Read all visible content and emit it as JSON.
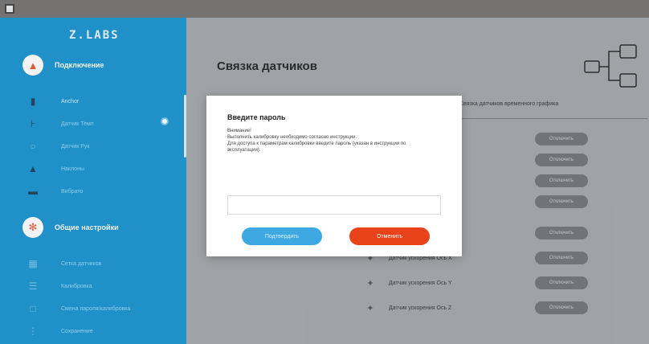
{
  "sidebar": {
    "logo": "Z.LABS",
    "section1": {
      "label": "Подключение"
    },
    "items1": [
      {
        "label": "Anchor",
        "icon": "sensor-icon"
      },
      {
        "label": "Датчик Темп",
        "icon": "thermometer-icon"
      },
      {
        "label": "Датчик Рук",
        "icon": "hand-icon"
      },
      {
        "label": "Наклоны",
        "icon": "image-icon"
      },
      {
        "label": "Вибрато",
        "icon": "image-icon"
      }
    ],
    "section2": {
      "label": "Общие настройки"
    },
    "items2": [
      {
        "label": "Сетка датчиков",
        "icon": "grid-icon"
      },
      {
        "label": "Калибровка",
        "icon": "list-icon"
      },
      {
        "label": "Смена пароля/калибровка",
        "icon": "lock-icon"
      },
      {
        "label": "Сохранение",
        "icon": "save-icon"
      }
    ]
  },
  "main": {
    "title": "Связка датчиков",
    "column_header": "Связка датчиков временного графика",
    "pill_label": "Отключить",
    "rows": [
      {
        "label": "Датчик ускорения Ось Х"
      },
      {
        "label": "Датчик ускорения Ось Y"
      },
      {
        "label": "Датчик ускорения Ось Z"
      }
    ]
  },
  "modal": {
    "title": "Введите пароль",
    "text": "Внимание!\nВыполнить калибровку необходимо согласно инструкции.\nДля доступа к параметрам калибровки введите пароль (указан в инструкции по эксплуатации).",
    "input_value": "",
    "input_placeholder": "",
    "confirm_label": "Подтвердить",
    "cancel_label": "Отменить"
  },
  "colors": {
    "sidebar": "#0f90cf",
    "confirm": "#3da8e2",
    "cancel": "#e8431b",
    "pill": "#6a6e73"
  }
}
